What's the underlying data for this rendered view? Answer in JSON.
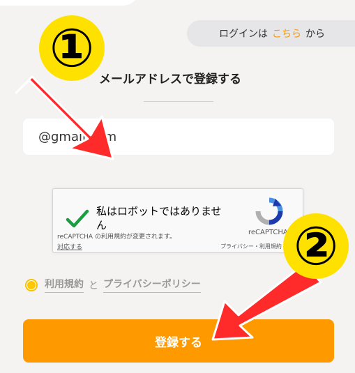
{
  "login_prompt": {
    "prefix": "ログインは",
    "link": "こちら",
    "suffix": "から"
  },
  "form": {
    "heading": "メールアドレスで登録する",
    "email_value": "@gmail.com",
    "submit_label": "登録する"
  },
  "recaptcha": {
    "checkbox_label": "私はロボットではありません",
    "notice": "reCAPTCHA の利用規約が変更されます。",
    "respond_link": "対応する",
    "brand": "reCAPTCHA",
    "privacy": "プライバシー・利用規約"
  },
  "terms": {
    "terms_link": "利用規約",
    "and": "と",
    "privacy_link": "プライバシーポリシー"
  },
  "annotations": {
    "step1": "①",
    "step2": "②"
  },
  "colors": {
    "accent": "#ff9900",
    "highlight": "#ffe100",
    "arrow": "#ff2a2a",
    "check": "#1a9e41"
  }
}
